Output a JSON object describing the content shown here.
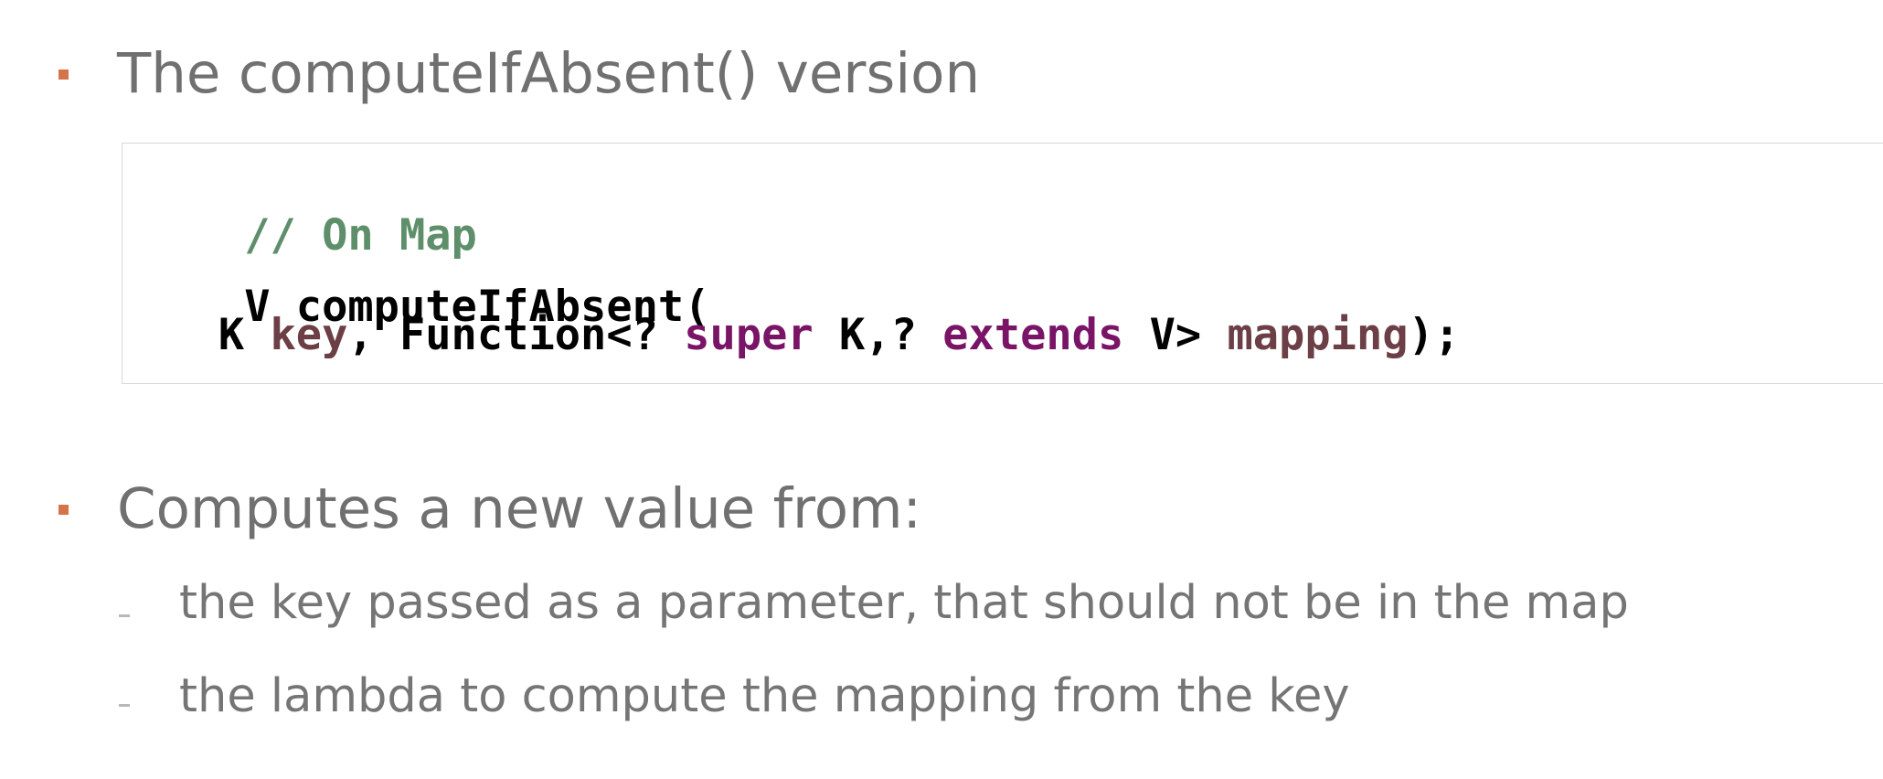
{
  "slide": {
    "heading1": "The computeIfAbsent() version",
    "code": {
      "comment": "// On Map",
      "line2": "V computeIfAbsent(",
      "line3": {
        "indent": "   ",
        "type_k": "K ",
        "param_key": "key",
        "after_key": ", Function<? ",
        "kw_super": "super",
        "mid": " K,? ",
        "kw_extends": "extends",
        "after_extends": " V> ",
        "param_mapping": "mapping",
        "end": ");"
      }
    },
    "heading2": "Computes a new value from:",
    "sub_items": [
      "the key passed as a parameter, that should not be in the map",
      "the lambda to compute the mapping from the key"
    ]
  },
  "colors": {
    "bullet": "#d5744a",
    "comment": "#5e8f6a",
    "parameter": "#6b3f45",
    "keyword": "#7a1467",
    "text": "#707070"
  }
}
